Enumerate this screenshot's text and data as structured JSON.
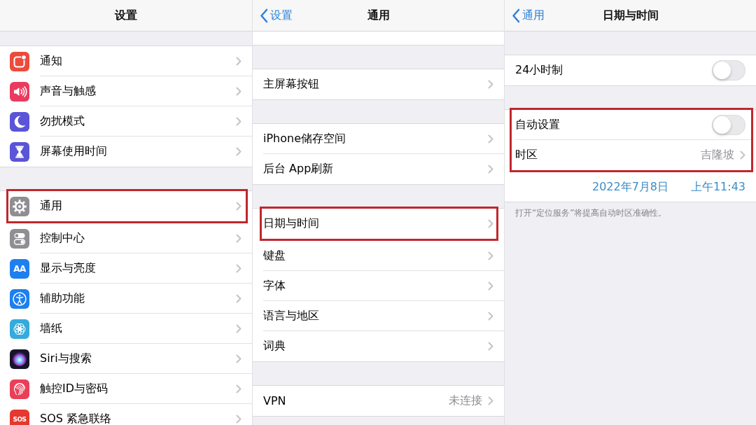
{
  "panels": [
    {
      "nav": {
        "title": "设置"
      },
      "groups": [
        {
          "rows": [
            {
              "kind": "link",
              "label": "通知",
              "highlighted": false
            },
            {
              "kind": "link",
              "label": "声音与触感",
              "highlighted": false
            },
            {
              "kind": "link",
              "label": "勿扰模式",
              "highlighted": false
            },
            {
              "kind": "link",
              "label": "屏幕使用时间",
              "highlighted": false
            }
          ]
        },
        {
          "rows": [
            {
              "kind": "link",
              "label": "通用",
              "highlighted": true
            },
            {
              "kind": "link",
              "label": "控制中心",
              "highlighted": false
            },
            {
              "kind": "link",
              "label": "显示与亮度",
              "icon_text": "AA",
              "highlighted": false
            },
            {
              "kind": "link",
              "label": "辅助功能",
              "highlighted": false
            },
            {
              "kind": "link",
              "label": "墙纸",
              "highlighted": false
            },
            {
              "kind": "link",
              "label": "Siri与搜索",
              "highlighted": false
            },
            {
              "kind": "link",
              "label": "触控ID与密码",
              "highlighted": false
            },
            {
              "kind": "link",
              "label": "SOS 紧急联络",
              "icon_text": "SOS",
              "highlighted": false
            }
          ]
        }
      ]
    },
    {
      "nav": {
        "back": "设置",
        "title": "通用"
      },
      "groups": [
        {
          "rows": [
            {
              "kind": "cut"
            }
          ]
        },
        {
          "rows": [
            {
              "kind": "link",
              "label": "主屏幕按钮",
              "highlighted": false
            }
          ]
        },
        {
          "rows": [
            {
              "kind": "link",
              "label": "iPhone储存空间",
              "highlighted": false
            },
            {
              "kind": "link",
              "label": "后台 App刷新",
              "highlighted": false
            }
          ]
        },
        {
          "rows": [
            {
              "kind": "link",
              "label": "日期与时间",
              "highlighted": true
            },
            {
              "kind": "link",
              "label": "键盘",
              "highlighted": false
            },
            {
              "kind": "link",
              "label": "字体",
              "highlighted": false
            },
            {
              "kind": "link",
              "label": "语言与地区",
              "highlighted": false
            },
            {
              "kind": "link",
              "label": "词典",
              "highlighted": false
            }
          ]
        },
        {
          "rows": [
            {
              "kind": "link",
              "label": "VPN",
              "value": "未连接",
              "highlighted": false
            }
          ]
        }
      ]
    },
    {
      "nav": {
        "back": "通用",
        "title": "日期与时间"
      },
      "groups": [
        {
          "rows": [
            {
              "kind": "toggle",
              "label": "24小时制",
              "on": false,
              "highlighted": false
            }
          ]
        },
        {
          "rows": [
            {
              "kind": "toggle",
              "label": "自动设置",
              "on": false,
              "highlighted": true
            },
            {
              "kind": "link",
              "label": "时区",
              "value": "吉隆坡",
              "highlighted": true
            },
            {
              "kind": "datetime",
              "date": "2022年7月8日",
              "time": "上午11:43",
              "highlighted": false
            }
          ],
          "footer": "打开“定位服务”将提高自动时区准确性。"
        }
      ]
    }
  ]
}
